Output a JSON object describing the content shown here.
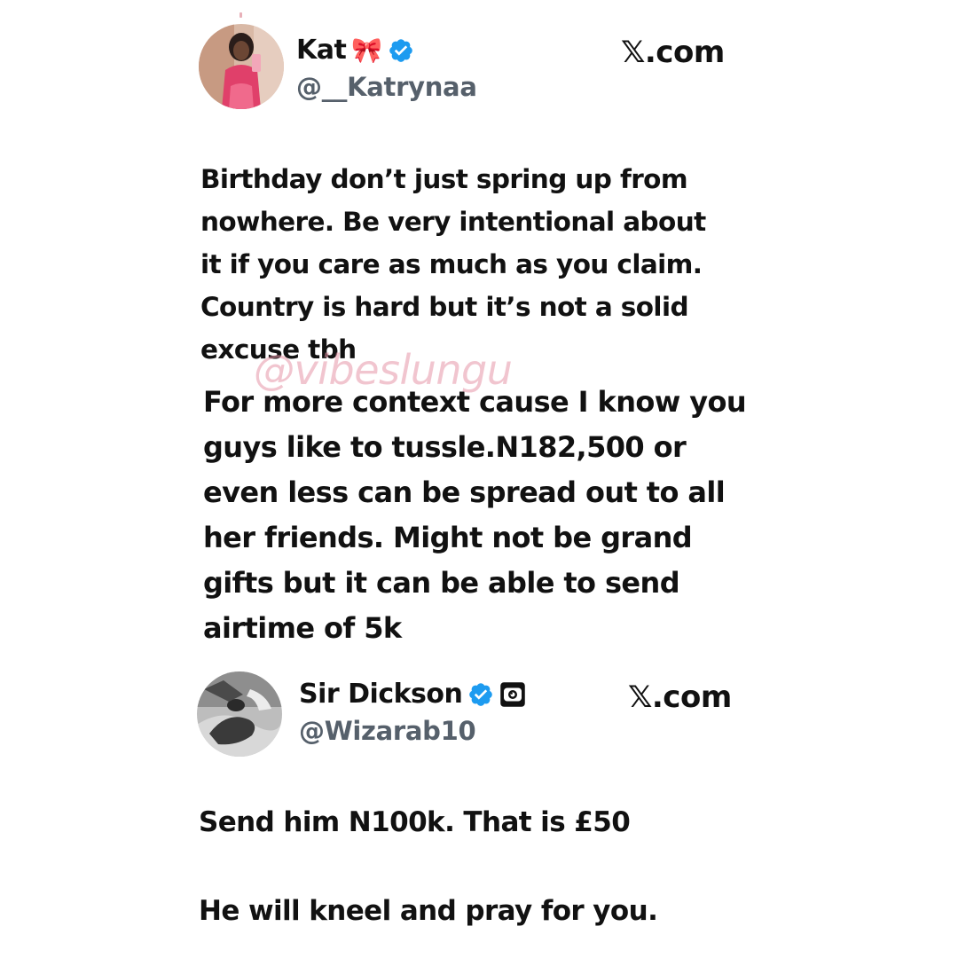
{
  "colors": {
    "verified_blue": "#1d9bf0",
    "handle_gray": "#56606b",
    "watermark_pink": "#e596a8",
    "text": "#111111"
  },
  "tweet1": {
    "author": {
      "name": "Kat",
      "emoji": "🎀",
      "handle": "@__Katrynaa",
      "verified_icon": "verified-badge-icon",
      "avatar_icon": "profile-photo"
    },
    "source": "𝕏.com",
    "text_lines": [
      "Birthday don’t just spring up from",
      "nowhere. Be very intentional about",
      "it if you care as much as you claim.",
      "Country is hard but it’s not a solid",
      "excuse tbh"
    ]
  },
  "watermark": "@vibeslungu",
  "context": {
    "text_lines": [
      "For more context cause I know you",
      "guys like to tussle.N182,500 or",
      "even less can be spread out to all",
      "her friends. Might not be grand",
      "gifts but it can be able to send",
      "airtime of 5k"
    ]
  },
  "tweet2": {
    "author": {
      "name": "Sir Dickson",
      "handle": "@Wizarab10",
      "verified_icon": "verified-badge-icon",
      "extra_icon": "camera-badge-icon",
      "avatar_icon": "profile-photo"
    },
    "source": "𝕏.com",
    "text_lines": [
      "Send him N100k. That is £50",
      "He will kneel and pray for you."
    ]
  }
}
